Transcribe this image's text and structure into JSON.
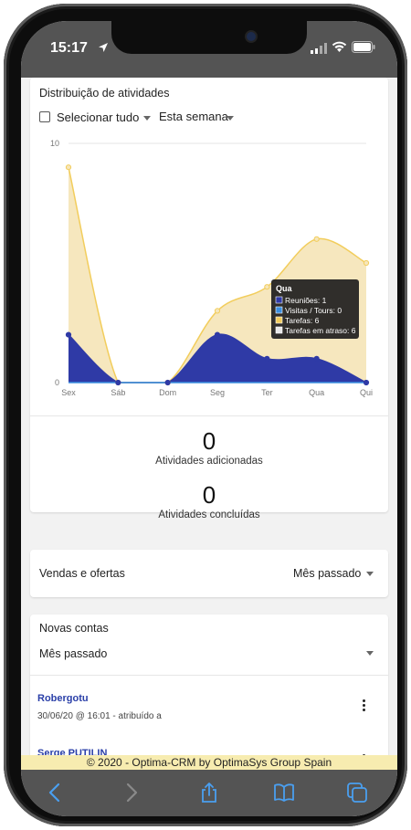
{
  "status": {
    "time": "15:17"
  },
  "activities": {
    "title": "Distribuição de atividades",
    "select_all": "Selecionar tudo",
    "period": "Esta semana",
    "added_count": "0",
    "added_label": "Atividades adicionadas",
    "done_count": "0",
    "done_label": "Atividades concluídas"
  },
  "chart_data": {
    "type": "area",
    "categories": [
      "Sex",
      "Sáb",
      "Dom",
      "Seg",
      "Ter",
      "Qua",
      "Qui"
    ],
    "ylim": [
      0,
      10
    ],
    "y_ticks": [
      "0",
      "10"
    ],
    "series": [
      {
        "name": "Reuniões",
        "color": "#2f3aa6",
        "values": [
          2,
          0,
          0,
          2,
          1,
          1,
          0
        ]
      },
      {
        "name": "Visitas / Tours",
        "color": "#3b8fe0",
        "values": [
          0,
          0,
          0,
          0,
          0,
          0,
          0
        ]
      },
      {
        "name": "Tarefas",
        "color": "#f2cd5c",
        "values": [
          9,
          0,
          0,
          3,
          4,
          6,
          5
        ]
      },
      {
        "name": "Tarefas em atraso",
        "color": "#e8e8e8",
        "values": [
          0,
          0,
          0,
          0,
          0,
          0,
          0
        ]
      }
    ],
    "tooltip": {
      "title": "Qua",
      "lines": [
        "Reuniões: 1",
        "Visitas / Tours: 0",
        "Tarefas: 6",
        "Tarefas em atraso: 6"
      ]
    }
  },
  "sales": {
    "label": "Vendas e ofertas",
    "period": "Mês passado"
  },
  "accounts": {
    "title": "Novas contas",
    "period": "Mês passado",
    "items": [
      {
        "name": "Robergotu",
        "meta": "30/06/20 @ 16:01 - atribuído a"
      },
      {
        "name": "Serge PUTILIN",
        "meta": ""
      }
    ]
  },
  "footer": {
    "text": "© 2020 - Optima-CRM by OptimaSys Group Spain"
  }
}
